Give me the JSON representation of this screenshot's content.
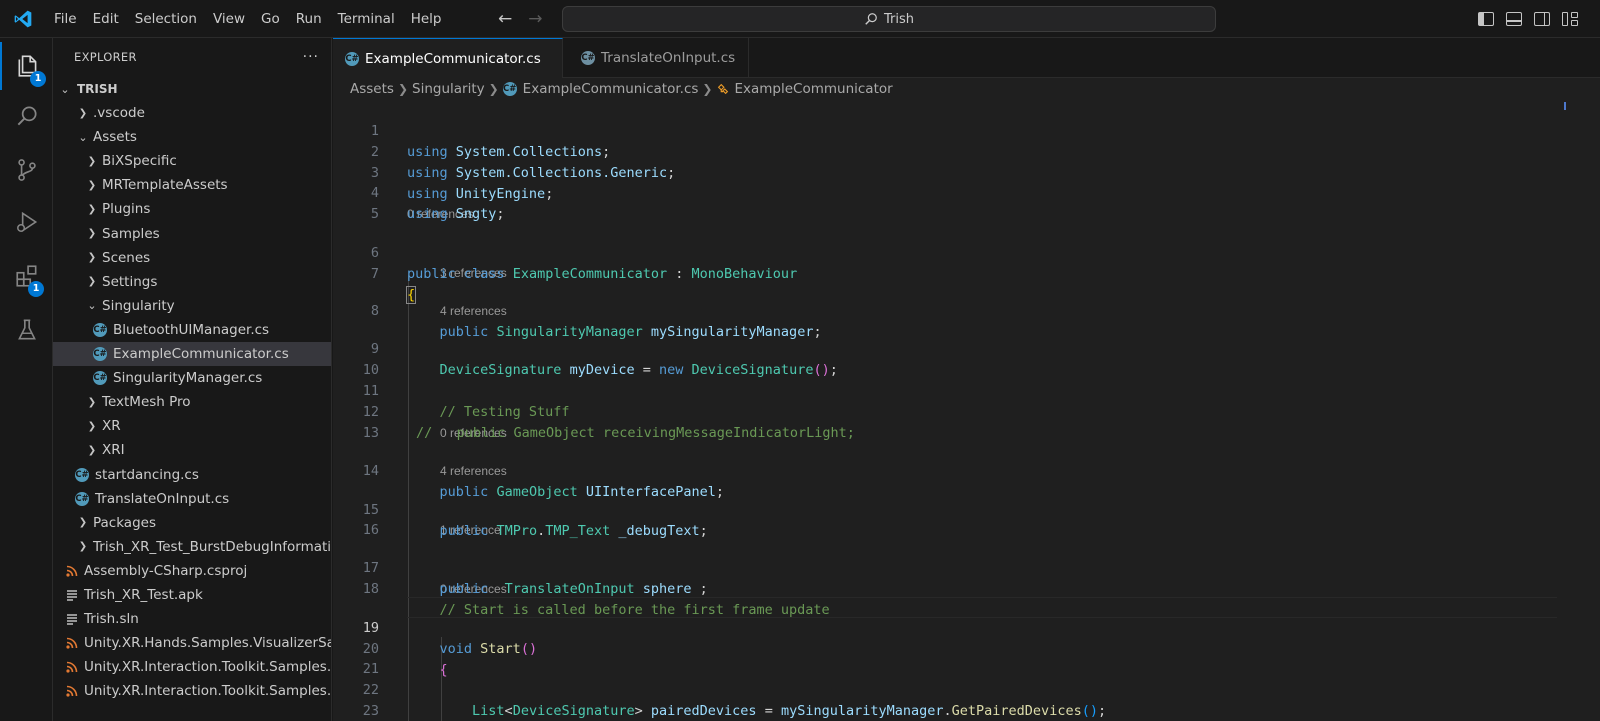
{
  "menu": [
    "File",
    "Edit",
    "Selection",
    "View",
    "Go",
    "Run",
    "Terminal",
    "Help"
  ],
  "search": {
    "text": "Trish"
  },
  "activity": {
    "explorer_badge": "1",
    "extensions_badge": "1"
  },
  "explorer": {
    "title": "EXPLORER",
    "more": "···",
    "root": "TRISH",
    "items": [
      {
        "label": ".vscode",
        "icon": "chevron-right"
      },
      {
        "label": "Assets",
        "icon": "chevron-down"
      },
      {
        "label": "BiXSpecific",
        "icon": "chevron-right"
      },
      {
        "label": "MRTemplateAssets",
        "icon": "chevron-right"
      },
      {
        "label": "Plugins",
        "icon": "chevron-right"
      },
      {
        "label": "Samples",
        "icon": "chevron-right"
      },
      {
        "label": "Scenes",
        "icon": "chevron-right"
      },
      {
        "label": "Settings",
        "icon": "chevron-right"
      },
      {
        "label": "Singularity",
        "icon": "chevron-down"
      },
      {
        "label": "BluetoothUIManager.cs",
        "icon": "csharp"
      },
      {
        "label": "ExampleCommunicator.cs",
        "icon": "csharp"
      },
      {
        "label": "SingularityManager.cs",
        "icon": "csharp"
      },
      {
        "label": "TextMesh Pro",
        "icon": "chevron-right"
      },
      {
        "label": "XR",
        "icon": "chevron-right"
      },
      {
        "label": "XRI",
        "icon": "chevron-right"
      },
      {
        "label": "startdancing.cs",
        "icon": "csharp"
      },
      {
        "label": "TranslateOnInput.cs",
        "icon": "csharp"
      },
      {
        "label": "Packages",
        "icon": "chevron-right"
      },
      {
        "label": "Trish_XR_Test_BurstDebugInformatio...",
        "icon": "chevron-right"
      },
      {
        "label": "Assembly-CSharp.csproj",
        "icon": "rss"
      },
      {
        "label": "Trish_XR_Test.apk",
        "icon": "lines"
      },
      {
        "label": "Trish.sln",
        "icon": "lines"
      },
      {
        "label": "Unity.XR.Hands.Samples.VisualizerSa...",
        "icon": "rss"
      },
      {
        "label": "Unity.XR.Interaction.Toolkit.Samples....",
        "icon": "rss"
      },
      {
        "label": "Unity.XR.Interaction.Toolkit.Samples....",
        "icon": "rss"
      }
    ],
    "selected_index": 10
  },
  "tabs": [
    {
      "label": "ExampleCommunicator.cs",
      "icon_text": "C#",
      "active": true
    },
    {
      "label": "TranslateOnInput.cs",
      "icon_text": "C#",
      "active": false
    }
  ],
  "breadcrumb": [
    "Assets",
    "Singularity",
    "ExampleCommunicator.cs",
    "ExampleCommunicator"
  ],
  "editor": {
    "current_line": "19",
    "lenses": {
      "l6": "0 references",
      "l8": "3 references",
      "l9": "4 references",
      "l14": "0 references",
      "l15": "4 references",
      "l17": "1 reference",
      "l19": "0 references"
    },
    "line_numbers": [
      "1",
      "2",
      "3",
      "4",
      "5",
      "6",
      "7",
      "8",
      "9",
      "10",
      "11",
      "12",
      "13",
      "14",
      "15",
      "16",
      "17",
      "18",
      "19",
      "20",
      "21",
      "22",
      "23"
    ],
    "tokens": {
      "using": "using",
      "l1_ns": "System.Collections",
      "l2_ns": "System.Collections.Generic",
      "l3_ns": "UnityEngine",
      "l4_ns": "Sngty",
      "semi": ";",
      "public": "public",
      "class": "class",
      "class_name": "ExampleCommunicator",
      "colon": " : ",
      "base": "MonoBehaviour",
      "open_brace": "{",
      "close_brace": "}",
      "l8_type": "SingularityManager",
      "l8_id": "mySingularityManager",
      "l9_type": "DeviceSignature",
      "l9_id": "myDevice",
      "eq": " = ",
      "new": "new",
      "l9_ctor": "DeviceSignature",
      "parens_open": "(",
      "parens_close": ")",
      "l11_comment": "// Testing Stuff",
      "l12_comment": "//   public GameObject receivingMessageIndicatorLight;",
      "l14_type": "GameObject",
      "l14_id": "UIInterfacePanel",
      "l15_ns": "TMPro",
      "dot": ".",
      "l15_type": "TMP_Text",
      "l15_id": "_debugText",
      "l17_type": "TranslateOnInput",
      "l17_id": "sphere",
      "l17_semi": " ;",
      "l18_comment": "// Start is called before the first frame update",
      "void": "void",
      "l19_fn": "Start",
      "l22_type": "List",
      "lt": "<",
      "l22_generic": "DeviceSignature",
      "gt": ">",
      "l22_id": "pairedDevices",
      "l22_obj": "mySingularityManager",
      "l22_fn": "GetPairedDevices"
    }
  }
}
